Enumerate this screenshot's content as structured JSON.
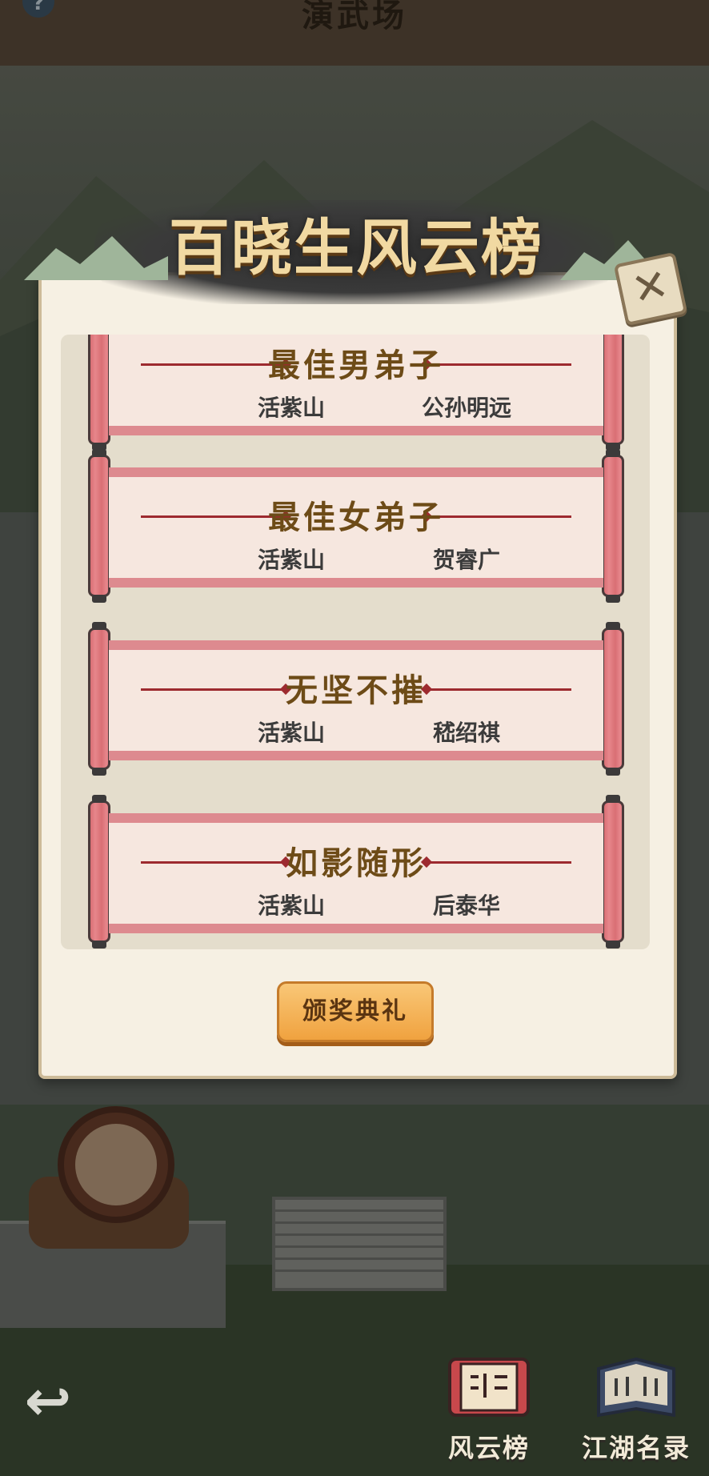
{
  "page": {
    "header_title": "演武场",
    "help_icon": "question-icon"
  },
  "modal": {
    "title": "百晓生风云榜",
    "close_icon": "close-icon",
    "ceremony_button": "颁奖典礼",
    "entries": [
      {
        "award": "最佳男弟子",
        "sect": "活紫山",
        "name": "公孙明远"
      },
      {
        "award": "最佳女弟子",
        "sect": "活紫山",
        "name": "贺睿广"
      },
      {
        "award": "无坚不摧",
        "sect": "活紫山",
        "name": "嵇绍祺"
      },
      {
        "award": "如影随形",
        "sect": "活紫山",
        "name": "后泰华"
      }
    ]
  },
  "bottom_nav": {
    "back_icon": "back-arrow-icon",
    "items": [
      {
        "label": "风云榜",
        "icon": "scroll-icon"
      },
      {
        "label": "江湖名录",
        "icon": "book-icon"
      }
    ]
  },
  "colors": {
    "accent_gold": "#f1d9a2",
    "scroll_red": "#dd8a8f",
    "button_orange": "#f0a23f"
  }
}
